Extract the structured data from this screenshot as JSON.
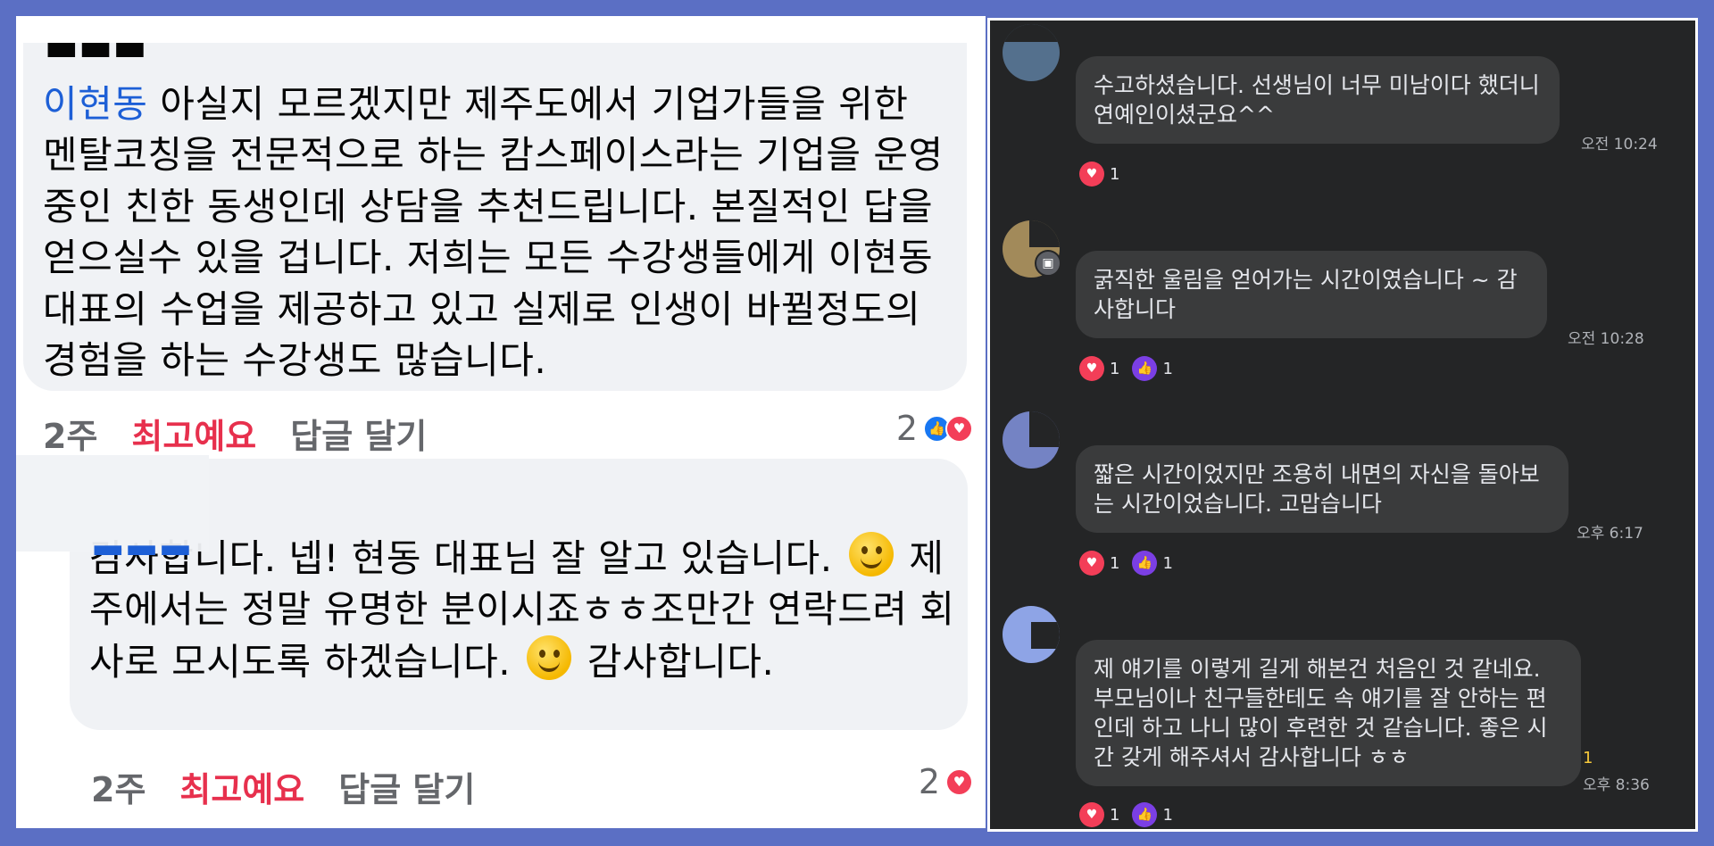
{
  "left": {
    "comment1": {
      "author": "이현동",
      "text": " 아실지 모르겠지만 제주도에서 기업가들을 위한 멘탈코칭을 전문적으로 하는 캄스페이스라는 기업을 운영중인 친한 동생인데 상담을 추천드립니다. 본질적인 답을 얻으실수 있을 겁니다. 저희는 모든 수강생들에게 이현동 대표의 수업을 제공하고 있고 실제로 인생이 바뀔정도의 경험을 하는 수강생도 많습니다.",
      "time": "2주",
      "liked_label": "최고예요",
      "reply_label": "답글 달기",
      "reaction_count": "2"
    },
    "comment2": {
      "text_part1": "감사합니다. 넵! 현동 대표님 잘 알고 있습니다.",
      "text_part2": "제주에서는 정말 유명한 분이시죠ㅎㅎ조만간 연락드려 회사로 모시도록 하겠습니다.",
      "text_part3": "감사합니다.",
      "time": "2주",
      "liked_label": "최고예요",
      "reply_label": "답글 달기",
      "reaction_count": "2"
    }
  },
  "right": {
    "messages": [
      {
        "text": "수고하셨습니다. 선생님이 너무 미남이다 했더니 연예인이셨군요^^",
        "time": "오전 10:24",
        "hearts": "1",
        "likes": ""
      },
      {
        "text": "굵직한 울림을 얻어가는 시간이였습니다 ~ 감사합니다",
        "time": "오전 10:28",
        "hearts": "1",
        "likes": "1"
      },
      {
        "text": "짧은 시간이었지만 조용히 내면의 자신을 돌아보는 시간이었습니다. 고맙습니다",
        "time": "오후 6:17",
        "hearts": "1",
        "likes": "1"
      },
      {
        "text": "제 얘기를 이렇게 길게 해본건 처음인 것 같네요. 부모님이나 친구들한테도 속 얘기를 잘 안하는 편인데 하고 나니 많이 후련한 것 같습니다. 좋은 시간 갖게 해주셔서 감사합니다 ㅎㅎ",
        "time": "오후 8:36",
        "unread": "1",
        "hearts": "1",
        "likes": "1"
      }
    ]
  },
  "icons": {
    "like": "thumbs-up-icon",
    "love": "heart-icon",
    "smile": "smiling-face-emoji",
    "group_badge": "group-badge-icon"
  },
  "colors": {
    "background_frame": "#5b6fc4",
    "fb_blue": "#1877f2",
    "fb_love": "#f33e58",
    "liked_label": "#e7304d",
    "dark_bg": "#242526",
    "dark_bubble": "#3a3b3c",
    "dark_like": "#7b3fe4"
  }
}
